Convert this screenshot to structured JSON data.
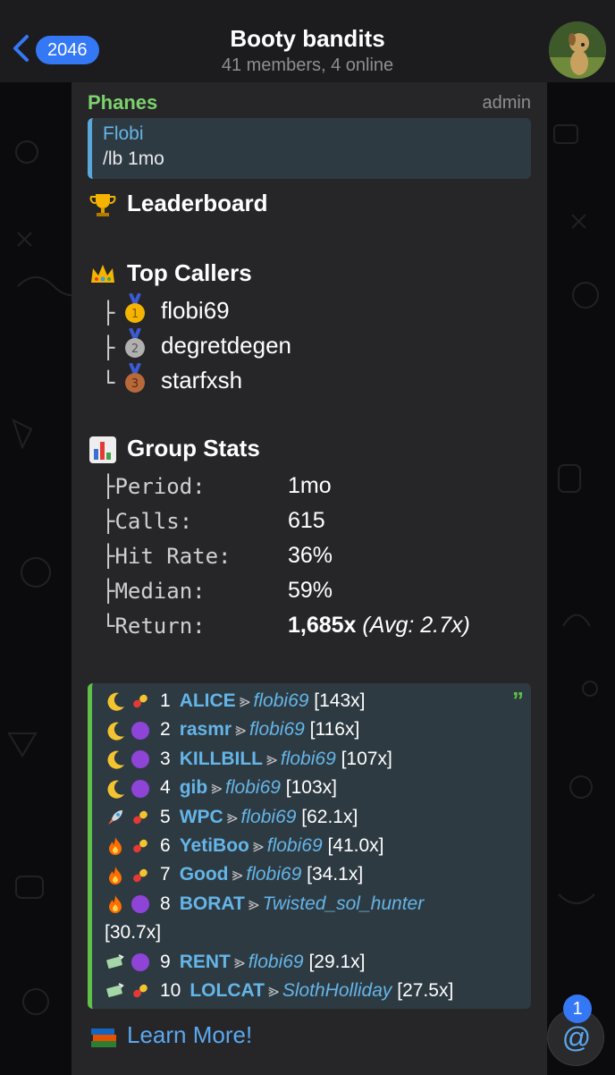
{
  "header": {
    "unread_count": "2046",
    "title": "Booty bandits",
    "subtitle": "41 members, 4 online"
  },
  "message": {
    "sender": "Phanes",
    "role": "admin",
    "reply": {
      "name": "Flobi",
      "text": "/lb 1mo"
    },
    "leaderboard_title": "Leaderboard",
    "top_callers_title": "Top Callers",
    "top_callers": [
      "flobi69",
      "degretdegen",
      "starfxsh"
    ],
    "group_stats_title": "Group Stats",
    "stats": [
      {
        "label": "Period:",
        "value": "1mo"
      },
      {
        "label": "Calls:",
        "value": "615"
      },
      {
        "label": "Hit Rate:",
        "value": "36%"
      },
      {
        "label": "Median:",
        "value": "59%"
      },
      {
        "label": "Return:",
        "value": "1,685x",
        "extra": "(Avg: 2.7x)"
      }
    ],
    "calls": [
      {
        "rank": "1",
        "token": "ALICE",
        "caller": "flobi69",
        "mult": "[143x]",
        "icons": [
          "moon-icon",
          "pill-icon"
        ]
      },
      {
        "rank": "2",
        "token": "rasmr",
        "caller": "flobi69",
        "mult": "[116x]",
        "icons": [
          "moon-icon",
          "purple-circle-icon"
        ]
      },
      {
        "rank": "3",
        "token": "KILLBILL",
        "caller": "flobi69",
        "mult": "[107x]",
        "icons": [
          "moon-icon",
          "purple-circle-icon"
        ]
      },
      {
        "rank": "4",
        "token": "gib",
        "caller": "flobi69",
        "mult": "[103x]",
        "icons": [
          "moon-icon",
          "purple-circle-icon"
        ]
      },
      {
        "rank": "5",
        "token": "WPC",
        "caller": "flobi69",
        "mult": "[62.1x]",
        "icons": [
          "rocket-icon",
          "pill-icon"
        ]
      },
      {
        "rank": "6",
        "token": "YetiBoo",
        "caller": "flobi69",
        "mult": "[41.0x]",
        "icons": [
          "fire-icon",
          "pill-icon"
        ]
      },
      {
        "rank": "7",
        "token": "Good",
        "caller": "flobi69",
        "mult": "[34.1x]",
        "icons": [
          "fire-icon",
          "pill-icon"
        ]
      },
      {
        "rank": "8",
        "token": "BORAT",
        "caller": "Twisted_sol_hunter",
        "mult": "[30.7x]",
        "icons": [
          "fire-icon",
          "purple-circle-icon"
        ]
      },
      {
        "rank": "9",
        "token": "RENT",
        "caller": "flobi69",
        "mult": "[29.1x]",
        "icons": [
          "money-icon",
          "purple-circle-icon"
        ]
      },
      {
        "rank": "10",
        "token": "LOLCAT",
        "caller": "SlothHolliday",
        "mult": "[27.5x]",
        "icons": [
          "money-icon",
          "pill-icon"
        ]
      }
    ],
    "learn_more": "Learn More!"
  },
  "mention_badge": "1",
  "mention_symbol": "@",
  "colors": {
    "accent": "#3478f6",
    "sender": "#7bd36d",
    "link": "#64b5e8",
    "quote_bar": "#60c04a"
  }
}
